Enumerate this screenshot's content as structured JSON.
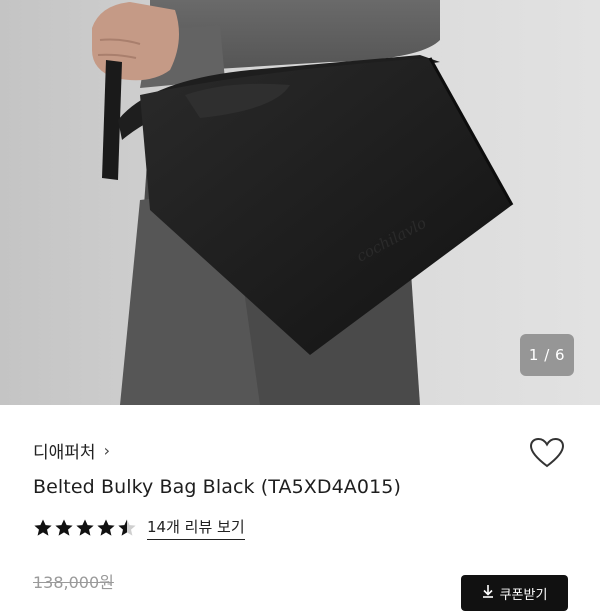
{
  "gallery": {
    "counter": "1 / 6",
    "bag_logo": "cochilavlo"
  },
  "product": {
    "brand": "디애퍼처",
    "brand_chevron": "›",
    "title": "Belted Bulky Bag Black (TA5XD4A015)",
    "rating": 4.5,
    "review_link": "14개 리뷰 보기",
    "original_price": "138,000원"
  },
  "actions": {
    "coupon_label": "쿠폰받기",
    "coupon_icon": "download-arrow-icon",
    "wishlist_icon": "heart-outline-icon"
  },
  "colors": {
    "star": "#111111",
    "button_bg": "#111111",
    "strike_price": "#9a9a9a"
  }
}
